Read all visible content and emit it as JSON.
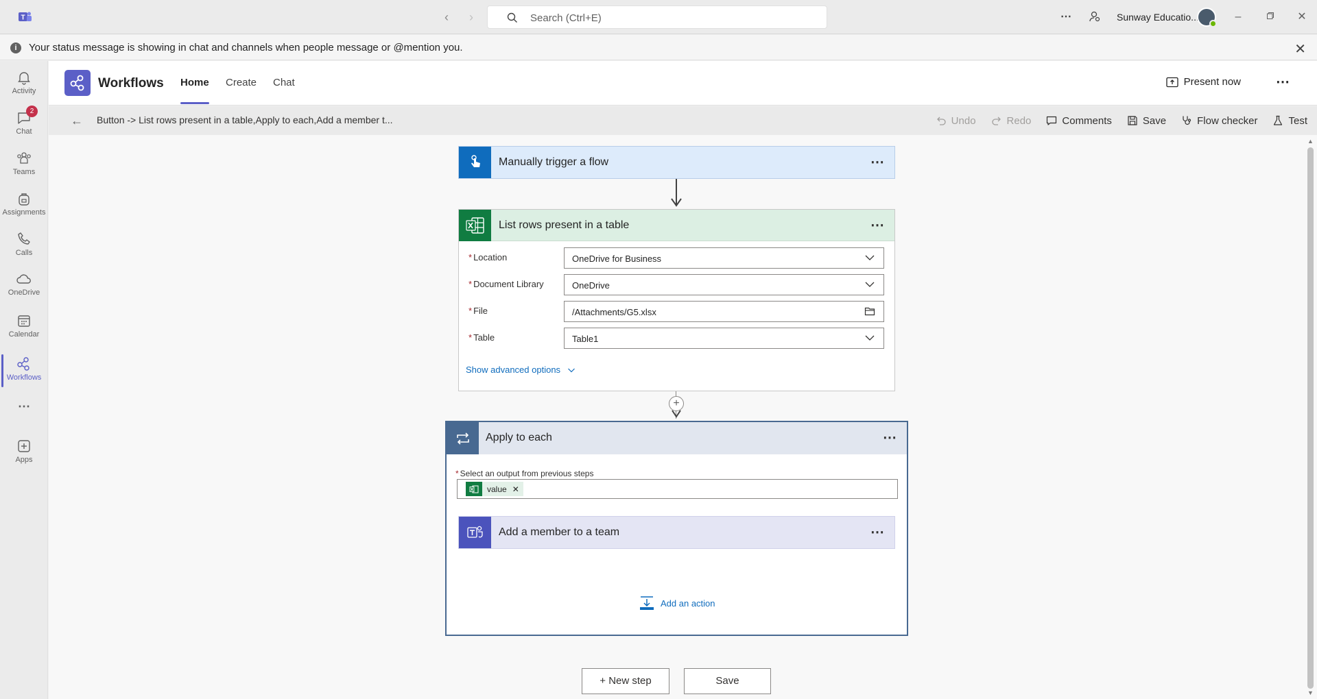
{
  "titlebar": {
    "search_placeholder": "Search (Ctrl+E)",
    "org_name": "Sunway Educatio..."
  },
  "banner": {
    "message": "Your status message is showing in chat and channels when people message or @mention you."
  },
  "rail": {
    "items": [
      {
        "label": "Activity",
        "icon": "bell-icon"
      },
      {
        "label": "Chat",
        "icon": "chat-icon",
        "badge": "2"
      },
      {
        "label": "Teams",
        "icon": "teams-icon"
      },
      {
        "label": "Assignments",
        "icon": "backpack-icon"
      },
      {
        "label": "Calls",
        "icon": "phone-icon"
      },
      {
        "label": "OneDrive",
        "icon": "cloud-icon"
      },
      {
        "label": "Calendar",
        "icon": "calendar-icon"
      },
      {
        "label": "Workflows",
        "icon": "workflows-icon",
        "active": true
      },
      {
        "label": "Apps",
        "icon": "add-app-icon"
      }
    ]
  },
  "app": {
    "title": "Workflows",
    "tabs": [
      "Home",
      "Create",
      "Chat"
    ],
    "active_tab": "Home",
    "present_label": "Present now"
  },
  "toolbar": {
    "flow_name": "Button -> List rows present in a table,Apply to each,Add a member t...",
    "undo": "Undo",
    "redo": "Redo",
    "comments": "Comments",
    "save": "Save",
    "flow_checker": "Flow checker",
    "test": "Test"
  },
  "flow": {
    "trigger": {
      "title": "Manually trigger a flow",
      "color": "#0f6cbd"
    },
    "list_rows": {
      "title": "List rows present in a table",
      "color": "#107c41",
      "fields": [
        {
          "label": "Location",
          "value": "OneDrive for Business",
          "kind": "dropdown"
        },
        {
          "label": "Document Library",
          "value": "OneDrive",
          "kind": "dropdown"
        },
        {
          "label": "File",
          "value": "/Attachments/G5.xlsx",
          "kind": "file"
        },
        {
          "label": "Table",
          "value": "Table1",
          "kind": "dropdown"
        }
      ],
      "advanced_label": "Show advanced options"
    },
    "apply_each": {
      "title": "Apply to each",
      "color": "#486991",
      "select_label": "Select an output from previous steps",
      "token": "value"
    },
    "add_member": {
      "title": "Add a member to a team",
      "color": "#4b53bc"
    },
    "add_action_label": "Add an action"
  },
  "bottom": {
    "new_step": "+ New step",
    "save": "Save"
  }
}
